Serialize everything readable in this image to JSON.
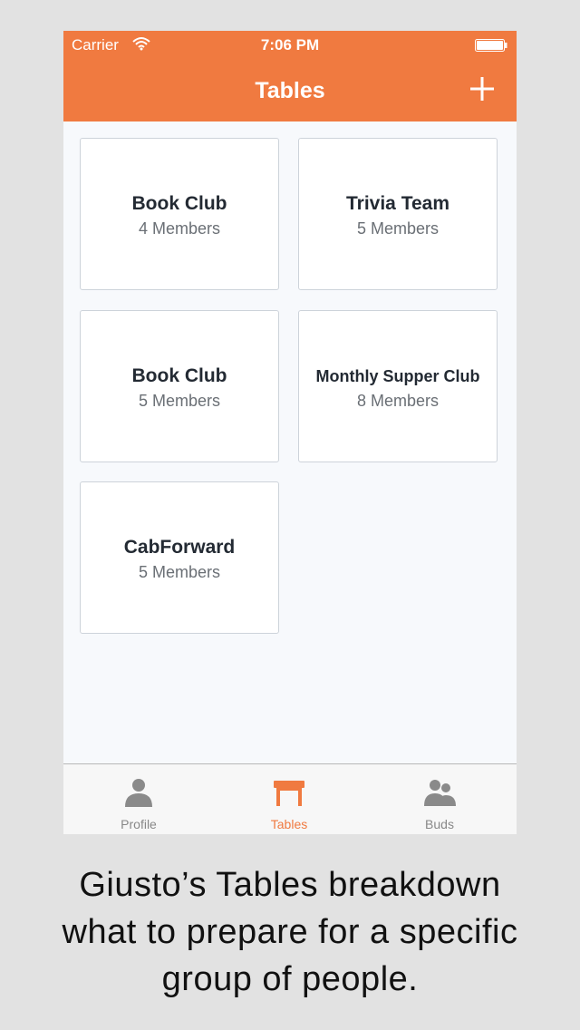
{
  "status_bar": {
    "carrier": "Carrier",
    "time": "7:06 PM",
    "wifi_icon": "wifi-icon",
    "battery_icon": "battery-icon"
  },
  "nav_bar": {
    "title": "Tables",
    "add_icon": "plus-icon",
    "color": "#f07a40"
  },
  "tables": [
    {
      "name": "Book Club",
      "members": "4 Members"
    },
    {
      "name": "Trivia Team",
      "members": "5 Members"
    },
    {
      "name": "Book Club",
      "members": "5 Members"
    },
    {
      "name": "Monthly Supper Club",
      "members": "8 Members"
    },
    {
      "name": "CabForward",
      "members": "5 Members"
    }
  ],
  "tab_bar": {
    "tabs": [
      {
        "label": "Profile",
        "icon": "person-icon",
        "active": false
      },
      {
        "label": "Tables",
        "icon": "table-icon",
        "active": true
      },
      {
        "label": "Buds",
        "icon": "group-icon",
        "active": false
      }
    ],
    "active_color": "#f07a40",
    "inactive_color": "#888888"
  },
  "caption": {
    "line1": "Giusto’s Tables breakdown",
    "line2": "what to prepare for a specific",
    "line3": "group of people."
  }
}
